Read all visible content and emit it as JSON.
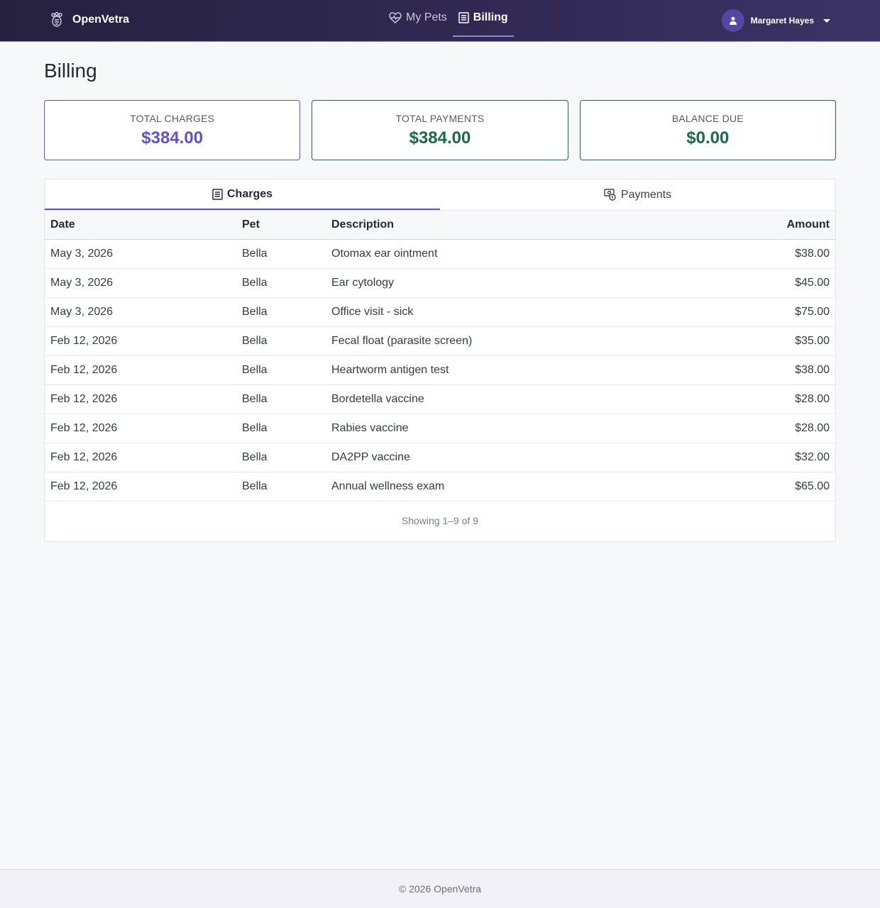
{
  "app": {
    "name": "OpenVetra",
    "nav": [
      {
        "label": "My Pets",
        "icon": "heart-pulse-icon",
        "active": false
      },
      {
        "label": "Billing",
        "icon": "receipt-icon",
        "active": true
      }
    ],
    "user": {
      "name": "Margaret Hayes",
      "icon": "user-icon"
    }
  },
  "page": {
    "title": "Billing"
  },
  "summary": {
    "total_charges": {
      "label": "TOTAL CHARGES",
      "value": "$384.00"
    },
    "total_payments": {
      "label": "TOTAL PAYMENTS",
      "value": "$384.00"
    },
    "balance_due": {
      "label": "BALANCE DUE",
      "value": "$0.00"
    }
  },
  "tabs": [
    {
      "label": "Charges",
      "icon": "receipt-icon",
      "active": true
    },
    {
      "label": "Payments",
      "icon": "cash-coin-icon",
      "active": false
    }
  ],
  "table": {
    "headers": {
      "date": "Date",
      "pet": "Pet",
      "description": "Description",
      "amount": "Amount"
    },
    "rows": [
      {
        "date": "May 3, 2026",
        "pet": "Bella",
        "description": "Otomax ear ointment",
        "amount": "$38.00"
      },
      {
        "date": "May 3, 2026",
        "pet": "Bella",
        "description": "Ear cytology",
        "amount": "$45.00"
      },
      {
        "date": "May 3, 2026",
        "pet": "Bella",
        "description": "Office visit - sick",
        "amount": "$75.00"
      },
      {
        "date": "Feb 12, 2026",
        "pet": "Bella",
        "description": "Fecal float (parasite screen)",
        "amount": "$35.00"
      },
      {
        "date": "Feb 12, 2026",
        "pet": "Bella",
        "description": "Heartworm antigen test",
        "amount": "$38.00"
      },
      {
        "date": "Feb 12, 2026",
        "pet": "Bella",
        "description": "Bordetella vaccine",
        "amount": "$28.00"
      },
      {
        "date": "Feb 12, 2026",
        "pet": "Bella",
        "description": "Rabies vaccine",
        "amount": "$28.00"
      },
      {
        "date": "Feb 12, 2026",
        "pet": "Bella",
        "description": "DA2PP vaccine",
        "amount": "$32.00"
      },
      {
        "date": "Feb 12, 2026",
        "pet": "Bella",
        "description": "Annual wellness exam",
        "amount": "$65.00"
      }
    ],
    "showing": "Showing 1–9 of 9"
  },
  "footer": {
    "text": "© 2026 OpenVetra"
  },
  "colors": {
    "accent": "#6352c4",
    "success": "#1a6b47",
    "nav_bg": "#2c2549"
  }
}
